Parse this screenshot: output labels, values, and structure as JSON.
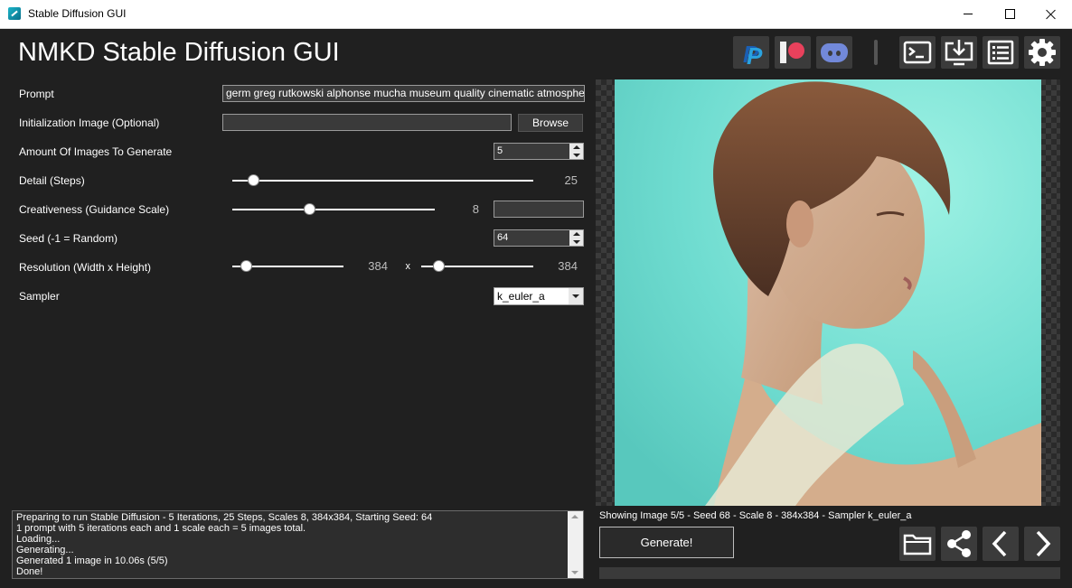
{
  "window": {
    "title": "Stable Diffusion GUI"
  },
  "header": {
    "title": "NMKD Stable Diffusion GUI"
  },
  "toolbar": {
    "icons": [
      "paypal-icon",
      "patreon-icon",
      "discord-icon",
      "terminal-icon",
      "install-icon",
      "list-icon",
      "gear-icon"
    ]
  },
  "form": {
    "prompt": {
      "label": "Prompt",
      "value": "germ greg rutkowski alphonse mucha museum quality cinematic atmospheric"
    },
    "init_image": {
      "label": "Initialization Image (Optional)",
      "value": "",
      "browse_label": "Browse"
    },
    "amount": {
      "label": "Amount Of Images To Generate",
      "value": "5"
    },
    "steps": {
      "label": "Detail (Steps)",
      "value": "25",
      "fraction": 0.07
    },
    "guidance": {
      "label": "Creativeness (Guidance Scale)",
      "value": "8",
      "fraction": 0.38,
      "text": ""
    },
    "seed": {
      "label": "Seed (-1 = Random)",
      "value": "64"
    },
    "resolution": {
      "label": "Resolution (Width x Height)",
      "width": "384",
      "height": "384",
      "separator": "x",
      "width_fraction": 0.12,
      "height_fraction": 0.15
    },
    "sampler": {
      "label": "Sampler",
      "value": "k_euler_a"
    }
  },
  "viewer": {
    "info": "Showing Image 5/5 - Seed 68 - Scale 8 - 384x384 - Sampler k_euler_a"
  },
  "actions": {
    "generate_label": "Generate!",
    "icons": [
      "folder-icon",
      "share-icon",
      "previous-icon",
      "next-icon"
    ]
  },
  "log": {
    "lines": [
      "Preparing to run Stable Diffusion - 5 Iterations, 25 Steps, Scales 8, 384x384, Starting Seed: 64",
      "1 prompt with 5 iterations each and 1 scale each = 5 images total.",
      "Loading...",
      "Generating...",
      "Generated 1 image in 10.06s (5/5)",
      "Done!"
    ]
  },
  "colors": {
    "background": "#202020",
    "panel": "#3b3b3b",
    "accent_patreon": "#e8415c",
    "accent_discord": "#7289da",
    "accent_paypal": "#1a5fb4"
  }
}
